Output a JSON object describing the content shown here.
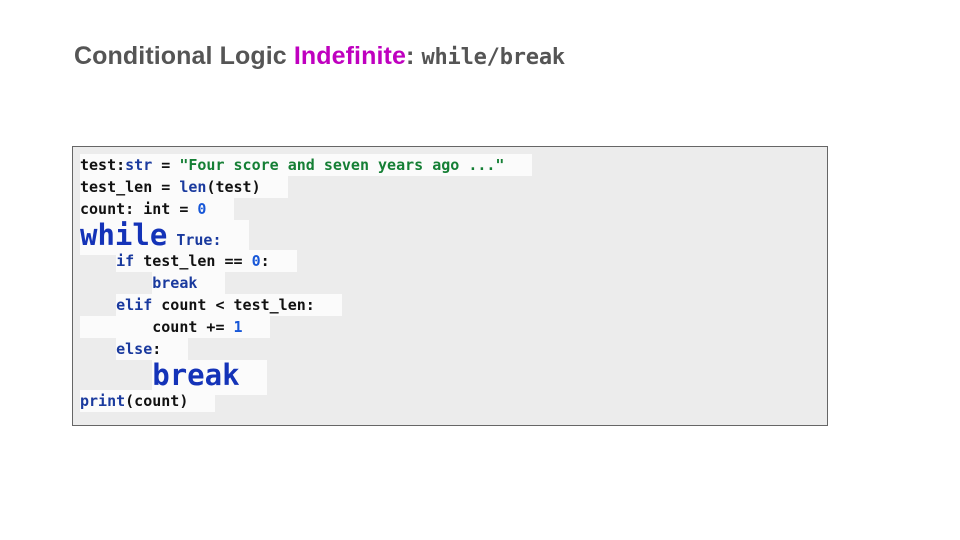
{
  "title": {
    "part1": "Conditional Logic ",
    "accent": "Indefinite",
    "colon": ": ",
    "mono": "while/break"
  },
  "colors": {
    "title_gray": "#555555",
    "accent_magenta": "#bf00bf",
    "keyword_navy": "#1a3a9e",
    "keyword_strong_blue": "#1433b8",
    "string_green": "#157f35",
    "number_blue": "#1757d8",
    "code_text_black": "#111111",
    "box_background": "#ececec",
    "box_border": "#666666",
    "line_highlight": "#fbfbfb"
  },
  "code": {
    "language": "python",
    "lines": [
      {
        "id": "line-1",
        "emphasis": false,
        "tokens": [
          {
            "text": "test:",
            "kind": "plain"
          },
          {
            "text": "str",
            "kind": "keyword"
          },
          {
            "text": " = ",
            "kind": "plain"
          },
          {
            "text": "\"Four score and seven years ago ...\"",
            "kind": "string"
          }
        ]
      },
      {
        "id": "line-2",
        "emphasis": false,
        "tokens": [
          {
            "text": "test_len = ",
            "kind": "plain"
          },
          {
            "text": "len",
            "kind": "keyword"
          },
          {
            "text": "(test)",
            "kind": "plain"
          }
        ]
      },
      {
        "id": "line-3",
        "emphasis": false,
        "tokens": [
          {
            "text": "count: int = ",
            "kind": "plain"
          },
          {
            "text": "0",
            "kind": "number"
          }
        ]
      },
      {
        "id": "line-4",
        "emphasis": true,
        "tokens": [
          {
            "text": "while",
            "kind": "keyword-strong",
            "big": true
          },
          {
            "text": " ",
            "kind": "plain"
          },
          {
            "text": "True",
            "kind": "keyword"
          },
          {
            "text": ":",
            "kind": "keyword"
          }
        ]
      },
      {
        "id": "line-5",
        "emphasis": false,
        "tokens": [
          {
            "text": "    ",
            "kind": "plain"
          },
          {
            "text": "if",
            "kind": "keyword"
          },
          {
            "text": " test_len == ",
            "kind": "plain"
          },
          {
            "text": "0",
            "kind": "number"
          },
          {
            "text": ":",
            "kind": "plain"
          }
        ]
      },
      {
        "id": "line-6",
        "emphasis": false,
        "tokens": [
          {
            "text": "        ",
            "kind": "plain"
          },
          {
            "text": "break",
            "kind": "keyword"
          }
        ]
      },
      {
        "id": "line-7",
        "emphasis": false,
        "tokens": [
          {
            "text": "    ",
            "kind": "plain"
          },
          {
            "text": "elif",
            "kind": "keyword"
          },
          {
            "text": " count < test_len:",
            "kind": "plain"
          }
        ]
      },
      {
        "id": "line-8",
        "emphasis": false,
        "tokens": [
          {
            "text": "        count += ",
            "kind": "plain"
          },
          {
            "text": "1",
            "kind": "number"
          }
        ]
      },
      {
        "id": "line-9",
        "emphasis": false,
        "tokens": [
          {
            "text": "    ",
            "kind": "plain"
          },
          {
            "text": "else",
            "kind": "keyword"
          },
          {
            "text": ":",
            "kind": "plain"
          }
        ]
      },
      {
        "id": "line-10",
        "emphasis": true,
        "tokens": [
          {
            "text": "        ",
            "kind": "plain"
          },
          {
            "text": "break",
            "kind": "keyword-strong",
            "big": true
          }
        ]
      },
      {
        "id": "line-11",
        "emphasis": false,
        "tokens": [
          {
            "text": "print",
            "kind": "keyword"
          },
          {
            "text": "(count)",
            "kind": "plain"
          }
        ]
      }
    ]
  }
}
